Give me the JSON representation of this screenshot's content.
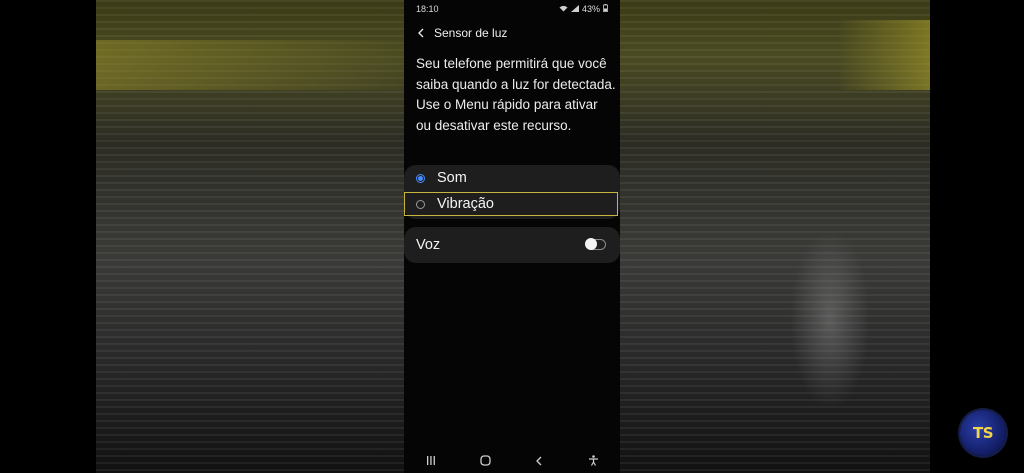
{
  "status_bar": {
    "time": "18:10",
    "battery": "43%",
    "icons": [
      "wifi-icon",
      "signal-icon",
      "battery-icon"
    ]
  },
  "header": {
    "back_icon": "chevron-left-icon",
    "title": "Sensor de luz"
  },
  "description": "Seu telefone permitirá que você saiba quando a luz for detectada. Use o Menu rápido para ativar ou desativar este recurso.",
  "options": [
    {
      "label": "Som",
      "selected": true
    },
    {
      "label": "Vibração",
      "selected": false
    }
  ],
  "voice_toggle": {
    "label": "Voz",
    "on": false
  },
  "nav_bar": {
    "icons": [
      "recent-apps-icon",
      "home-icon",
      "back-icon",
      "accessibility-icon"
    ]
  },
  "logo": {
    "text": "TS"
  },
  "colors": {
    "accent": "#4a8dff",
    "focus_outline": "#c9b441",
    "card": "#1e1e1e",
    "screen": "#050505"
  }
}
